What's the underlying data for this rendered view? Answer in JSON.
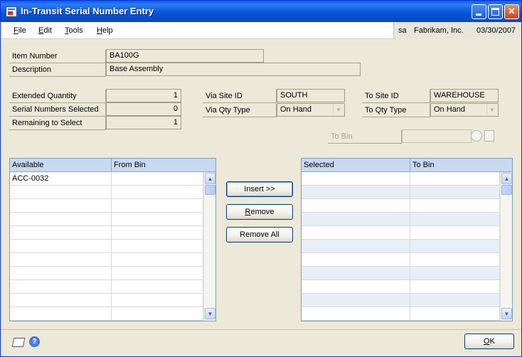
{
  "window": {
    "title": "In-Transit Serial Number Entry"
  },
  "menu": [
    {
      "label": "File"
    },
    {
      "label": "Edit"
    },
    {
      "label": "Tools"
    },
    {
      "label": "Help"
    }
  ],
  "session": {
    "user": "sa",
    "company": "Fabrikam, Inc.",
    "date": "03/30/2007"
  },
  "item": {
    "item_number_label": "Item Number",
    "item_number": "BA100G",
    "description_label": "Description",
    "description": "Base Assembly"
  },
  "quantities": {
    "extended_label": "Extended Quantity",
    "extended": "1",
    "selected_label": "Serial Numbers Selected",
    "selected": "0",
    "remaining_label": "Remaining to Select",
    "remaining": "1"
  },
  "via": {
    "site_label": "Via Site ID",
    "site": "SOUTH",
    "qty_type_label": "Via Qty Type",
    "qty_type": "On Hand"
  },
  "to": {
    "site_label": "To Site ID",
    "site": "WAREHOUSE",
    "qty_type_label": "To Qty Type",
    "qty_type": "On Hand",
    "bin_label": "To Bin",
    "bin": ""
  },
  "available_grid": {
    "columns": [
      "Available",
      "From Bin"
    ],
    "rows": [
      {
        "available": "ACC-0032",
        "bin": ""
      }
    ]
  },
  "selected_grid": {
    "columns": [
      "Selected",
      "To Bin"
    ],
    "rows": []
  },
  "actions": {
    "insert": "Insert >>",
    "remove": "Remove",
    "remove_all": "Remove All",
    "ok": "OK"
  },
  "icons": {
    "app": "serial-entry-icon",
    "minimize": "minimize-icon",
    "maximize": "maximize-icon",
    "close": "close-icon",
    "note": "note-icon",
    "help": "help-icon"
  }
}
